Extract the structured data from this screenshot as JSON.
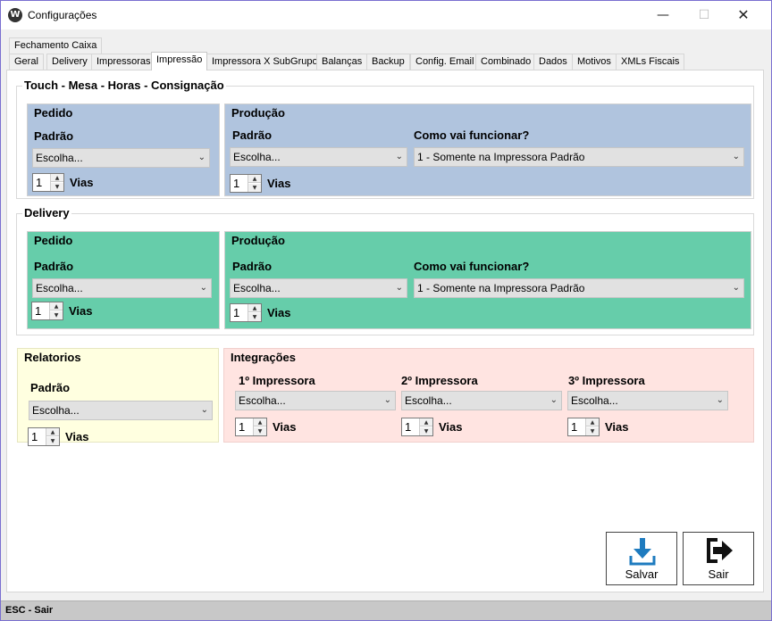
{
  "window": {
    "title": "Configurações",
    "minimize": "—",
    "maximize": "☐",
    "close": "✕"
  },
  "tabs_row1": [
    "Fechamento Caixa"
  ],
  "tabs_row2": [
    "Geral",
    "Delivery",
    "Impressoras",
    "Impressão",
    "Impressora X SubGrupo",
    "Balanças",
    "Backup",
    "Config. Email",
    "Combinado",
    "Dados",
    "Motivos",
    "XMLs Fiscais"
  ],
  "active_tab": "Impressão",
  "touch": {
    "title": "Touch - Mesa - Horas - Consignação",
    "pedido": {
      "title": "Pedido",
      "label": "Padrão",
      "select": "Escolha...",
      "vias_value": "1",
      "vias_label": "Vias"
    },
    "producao": {
      "title": "Produção",
      "label": "Padrão",
      "select": "Escolha...",
      "vias_value": "1",
      "vias_label": "Vias",
      "como_label": "Como vai funcionar?",
      "como_value": "1 - Somente na Impressora Padrão"
    }
  },
  "delivery": {
    "title": "Delivery",
    "pedido": {
      "title": "Pedido",
      "label": "Padrão",
      "select": "Escolha...",
      "vias_value": "1",
      "vias_label": "Vias"
    },
    "producao": {
      "title": "Produção",
      "label": "Padrão",
      "select": "Escolha...",
      "vias_value": "1",
      "vias_label": "Vias",
      "como_label": "Como vai funcionar?",
      "como_value": "1 - Somente na Impressora Padrão"
    }
  },
  "relatorios": {
    "title": "Relatorios",
    "label": "Padrão",
    "select": "Escolha...",
    "vias_value": "1",
    "vias_label": "Vias"
  },
  "integracoes": {
    "title": "Integrações",
    "printers": [
      {
        "label": "1º Impressora",
        "select": "Escolha...",
        "vias_value": "1",
        "vias_label": "Vias"
      },
      {
        "label": "2º Impressora",
        "select": "Escolha...",
        "vias_value": "1",
        "vias_label": "Vias"
      },
      {
        "label": "3º Impressora",
        "select": "Escolha...",
        "vias_value": "1",
        "vias_label": "Vias"
      }
    ]
  },
  "buttons": {
    "save": "Salvar",
    "exit": "Sair"
  },
  "statusbar": "ESC - Sair",
  "icons": {
    "chevron": "⌄",
    "spin_up": "▲",
    "spin_down": "▼",
    "app": "W"
  },
  "colors": {
    "touch_panel": "#b0c4de",
    "delivery_panel": "#66cdaa",
    "relatorios_panel": "#ffffe0",
    "integracoes_panel": "#ffe4e1",
    "save_icon": "#1e7bbf"
  }
}
